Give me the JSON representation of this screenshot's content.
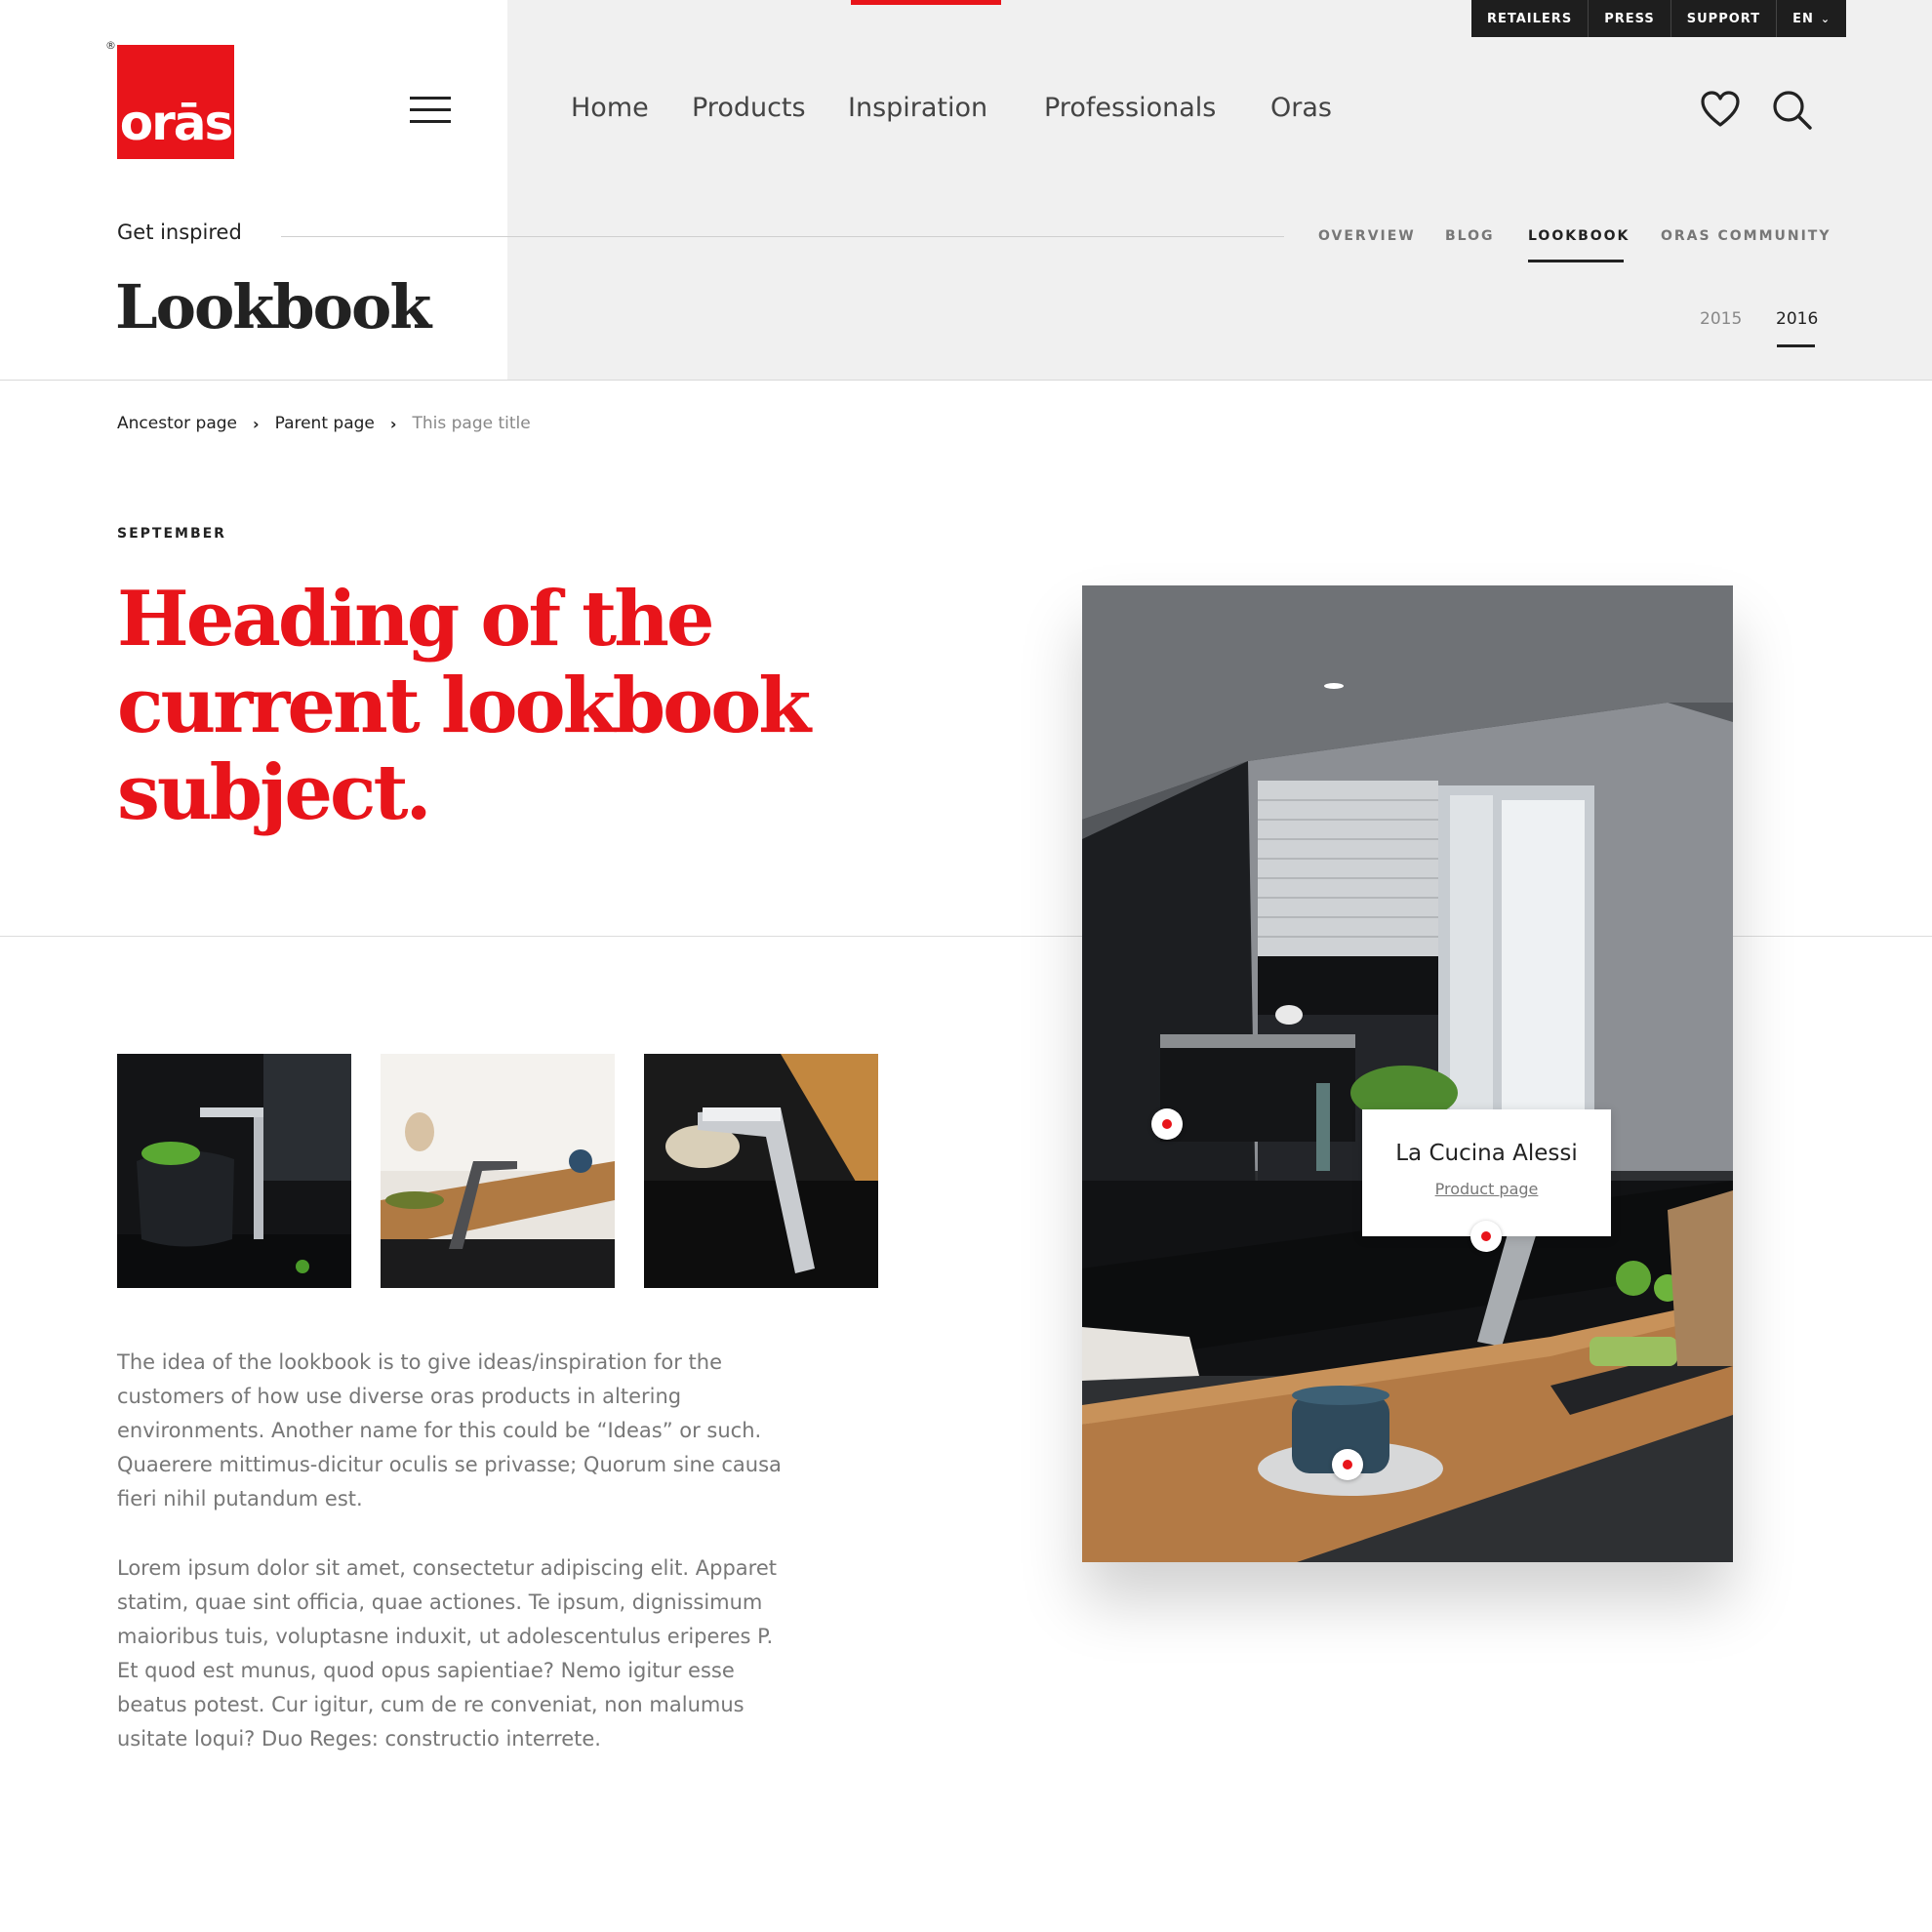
{
  "brand": {
    "logo_text": "orās",
    "registered": "®",
    "accent_color": "#e8141a"
  },
  "utility_nav": {
    "items": [
      "RETAILERS",
      "PRESS",
      "SUPPORT"
    ],
    "language": "EN"
  },
  "main_nav": {
    "items": [
      "Home",
      "Products",
      "Inspiration",
      "Professionals",
      "Oras"
    ],
    "icons": [
      "heart-icon",
      "search-icon",
      "hamburger-icon"
    ]
  },
  "section": {
    "label": "Get inspired",
    "tabs": [
      "OVERVIEW",
      "BLOG",
      "LOOKBOOK",
      "ORAS COMMUNITY"
    ],
    "active_tab": "LOOKBOOK",
    "title": "Lookbook",
    "years": [
      "2015",
      "2016"
    ],
    "active_year": "2016"
  },
  "breadcrumb": {
    "items": [
      "Ancestor page",
      "Parent page"
    ],
    "current": "This page title"
  },
  "article": {
    "month": "SEPTEMBER",
    "heading_lines": [
      "Heading of the",
      "current lookbook",
      "subject."
    ],
    "paragraphs": [
      "The idea of the lookbook is to give ideas/inspiration for the customers of how use diverse oras products in altering environments. Another name for this could be “Ideas” or such. Quaerere mittimus-dicitur oculis se privasse; Quorum sine causa fieri nihil putandum est.",
      "Lorem ipsum dolor sit amet, consectetur adipiscing elit. Apparet statim, quae sint officia, quae actiones. Te ipsum, dignissimum maioribus tuis, voluptasne induxit, ut adolescentulus eriperes P. Et quod est munus, quod opus sapientiae? Nemo igitur esse beatus potest. Cur igitur, cum de re conveniat, non malumus usitate loqui? Duo Reges: constructio interrete."
    ]
  },
  "hero": {
    "tooltip": {
      "title": "La Cucina Alessi",
      "link": "Product page"
    }
  }
}
